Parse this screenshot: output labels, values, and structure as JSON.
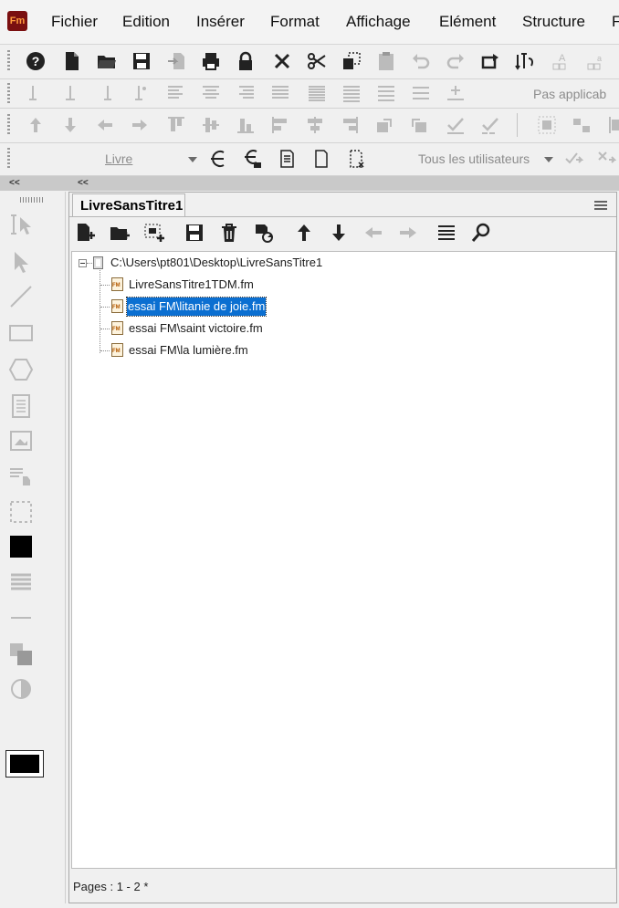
{
  "app": {
    "logo_text": "Fm",
    "accent": "#7a0f10",
    "logo_fg": "#ff9b3d"
  },
  "menu": [
    "Fichier",
    "Edition",
    "Insérer",
    "Format",
    "Affichage",
    "Elément",
    "Structure",
    "F"
  ],
  "toolbar": {
    "row1": [
      "help-icon",
      "new-document-icon",
      "open-folder-icon",
      "save-icon",
      "import-icon",
      "print-icon",
      "lock-icon",
      "delete-icon",
      "cut-icon",
      "copy-icon",
      "paste-icon",
      "undo-icon",
      "redo-icon",
      "repeat-icon",
      "spellcheck-icon",
      "font-larger-icon",
      "font-smaller-icon",
      "pilcrow-icon"
    ],
    "row2_right_label": "Pas applicab",
    "row4": {
      "book_combo": "Livre",
      "users_combo": "Tous les utilisateurs"
    }
  },
  "collapse": {
    "left": "<<",
    "right": "<<"
  },
  "panel": {
    "tab_title": "LivreSansTitre1",
    "tree": {
      "root": "C:\\Users\\pt801\\Desktop\\LivreSansTitre1",
      "items": [
        {
          "label": "LivreSansTitre1TDM.fm",
          "selected": false
        },
        {
          "label": "essai FM\\litanie de joie.fm",
          "selected": true
        },
        {
          "label": "essai FM\\saint victoire.fm",
          "selected": false
        },
        {
          "label": "essai FM\\la lumière.fm",
          "selected": false
        }
      ]
    },
    "status": "Pages : 1 - 2 *",
    "selection_color": "#0b6fd1"
  }
}
